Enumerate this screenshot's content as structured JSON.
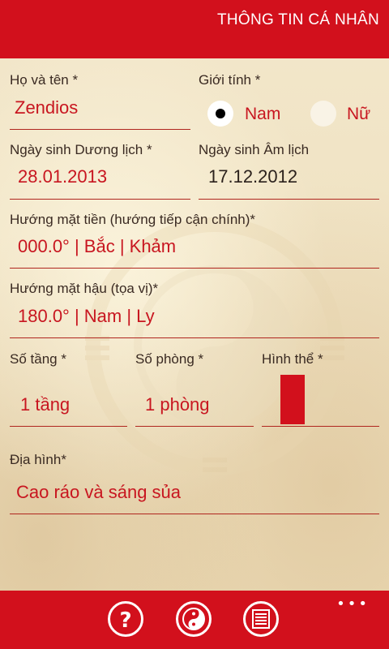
{
  "header": {
    "title": "THÔNG TIN CÁ NHÂN"
  },
  "form": {
    "name_label": "Họ và tên *",
    "name_value": "Zendios",
    "gender_label": "Giới tính *",
    "gender_options": [
      "Nam",
      "Nữ"
    ],
    "gender_selected": "Nam",
    "solar_birth_label": "Ngày sinh Dương lịch *",
    "solar_birth_value": "28.01.2013",
    "lunar_birth_label": "Ngày sinh Âm lịch",
    "lunar_birth_value": "17.12.2012",
    "front_dir_label": "Hướng mặt tiền (hướng tiếp cận chính)*",
    "front_dir_value": "000.0° | Bắc | Khảm",
    "back_dir_label": "Hướng mặt hậu (tọa vị)*",
    "back_dir_value": "180.0° | Nam | Ly",
    "floors_label": "Số tầng *",
    "floors_value": "1 tầng",
    "rooms_label": "Số phòng *",
    "rooms_value": "1 phòng",
    "shape_label": "Hình thể *",
    "terrain_label": "Địa hình*",
    "terrain_value": "Cao ráo và sáng sủa"
  },
  "appbar": {
    "buttons": [
      {
        "icon": "help-icon"
      },
      {
        "icon": "yin-yang-icon"
      },
      {
        "icon": "list-icon"
      }
    ],
    "more_icon": "more-icon"
  },
  "colors": {
    "accent": "#d2101c",
    "text_red": "#c81620",
    "paper": "#efe3c4"
  }
}
